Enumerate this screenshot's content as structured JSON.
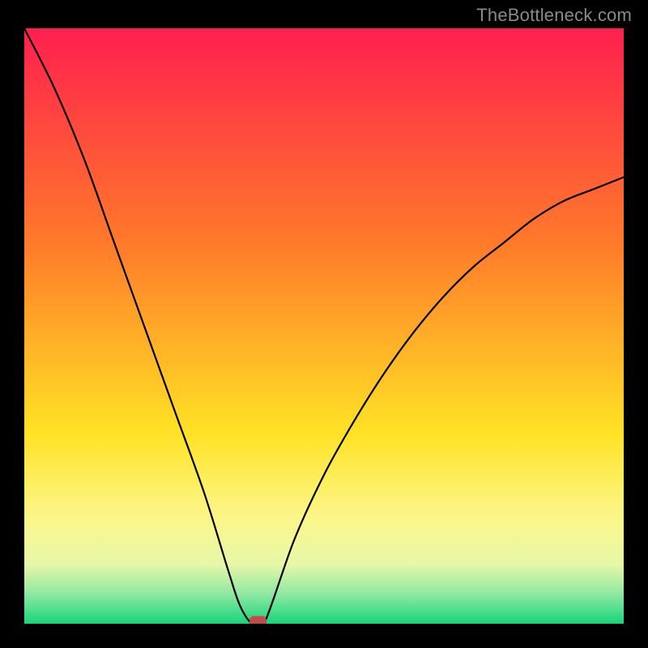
{
  "watermark": "TheBottleneck.com",
  "colors": {
    "gradient": {
      "c0": "#ff1f4f",
      "c1": "#ff7a2a",
      "c2": "#ffe225",
      "c3": "#fcf689",
      "c4": "#e7f7a8",
      "c5": "#8fe8a2",
      "c6": "#18d47a"
    },
    "curve": "#000000",
    "marker": "#c24a48",
    "frame": "#000000"
  },
  "chart_data": {
    "type": "line",
    "title": "",
    "xlabel": "",
    "ylabel": "",
    "xlim": [
      0,
      100
    ],
    "ylim": [
      0,
      100
    ],
    "legend": false,
    "grid": false,
    "annotations": [
      {
        "text": "TheBottleneck.com",
        "position": "top-right"
      }
    ],
    "marker": {
      "x": 39,
      "y": 0,
      "shape": "rounded-rect"
    },
    "series": [
      {
        "name": "left-branch",
        "x": [
          0,
          5,
          10,
          15,
          20,
          25,
          30,
          34,
          36,
          38
        ],
        "y": [
          100,
          90,
          78,
          64,
          50,
          36,
          22,
          9,
          3,
          0
        ]
      },
      {
        "name": "floor",
        "x": [
          38,
          40
        ],
        "y": [
          0,
          0
        ]
      },
      {
        "name": "right-branch",
        "x": [
          40,
          45,
          50,
          55,
          60,
          65,
          70,
          75,
          80,
          85,
          90,
          95,
          100
        ],
        "y": [
          0,
          14,
          25,
          34,
          42,
          49,
          55,
          60,
          64,
          68,
          71,
          73,
          75
        ]
      }
    ]
  }
}
